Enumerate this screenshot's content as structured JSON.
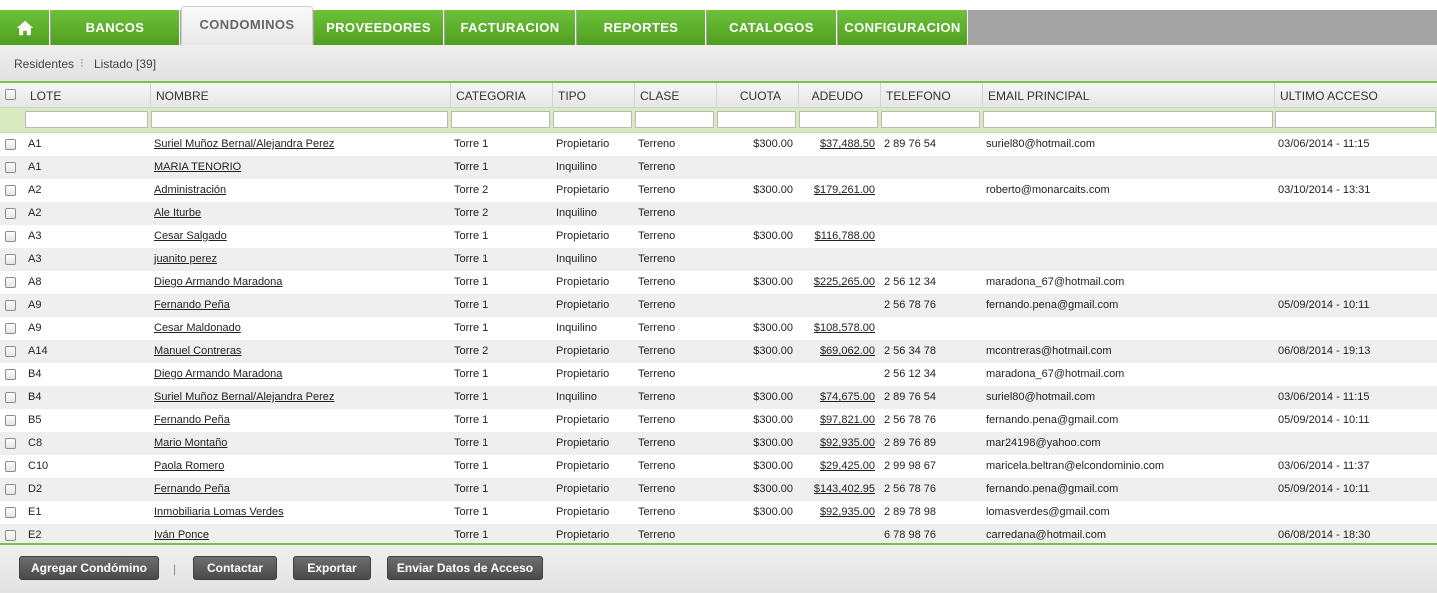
{
  "nav": {
    "home_icon": "home-icon",
    "tabs": [
      "BANCOS",
      "CONDOMINOS",
      "PROVEEDORES",
      "FACTURACION",
      "REPORTES",
      "CATALOGOS",
      "CONFIGURACION"
    ],
    "active": "CONDOMINOS"
  },
  "breadcrumb": {
    "parent": "Residentes",
    "current": "Listado [39]"
  },
  "table": {
    "headers": [
      "LOTE",
      "NOMBRE",
      "CATEGORIA",
      "TIPO",
      "CLASE",
      "CUOTA",
      "ADEUDO",
      "TELEFONO",
      "EMAIL PRINCIPAL",
      "ULTIMO ACCESO"
    ],
    "filters": [
      "",
      "",
      "",
      "",
      "",
      "",
      "",
      "",
      "",
      ""
    ],
    "rows": [
      [
        "A1",
        "Suriel Muñoz Bernal/Alejandra Perez",
        "Torre 1",
        "Propietario",
        "Terreno",
        "$300.00",
        "$37,488.50",
        "2 89 76 54",
        "suriel80@hotmail.com",
        "03/06/2014 - 11:15"
      ],
      [
        "A1",
        "MARIA TENORIO",
        "Torre 1",
        "Inquilino",
        "Terreno",
        "",
        "",
        "",
        "",
        ""
      ],
      [
        "A2",
        "Administración",
        "Torre 2",
        "Propietario",
        "Terreno",
        "$300.00",
        "$179,261.00",
        "",
        "roberto@monarcaits.com",
        "03/10/2014 - 13:31"
      ],
      [
        "A2",
        "Ale Iturbe",
        "Torre 2",
        "Inquilino",
        "Terreno",
        "",
        "",
        "",
        "",
        ""
      ],
      [
        "A3",
        "Cesar Salgado",
        "Torre 1",
        "Propietario",
        "Terreno",
        "$300.00",
        "$116,788.00",
        "",
        "",
        ""
      ],
      [
        "A3",
        "juanito perez",
        "Torre 1",
        "Inquilino",
        "Terreno",
        "",
        "",
        "",
        "",
        ""
      ],
      [
        "A8",
        "Diego Armando Maradona",
        "Torre 1",
        "Propietario",
        "Terreno",
        "$300.00",
        "$225,265.00",
        "2 56 12 34",
        "maradona_67@hotmail.com",
        ""
      ],
      [
        "A9",
        "Fernando Peña",
        "Torre 1",
        "Propietario",
        "Terreno",
        "",
        "",
        "2 56 78 76",
        "fernando.pena@gmail.com",
        "05/09/2014 - 10:11"
      ],
      [
        "A9",
        "Cesar Maldonado",
        "Torre 1",
        "Inquilino",
        "Terreno",
        "$300.00",
        "$108,578.00",
        "",
        "",
        ""
      ],
      [
        "A14",
        "Manuel Contreras",
        "Torre 2",
        "Propietario",
        "Terreno",
        "$300.00",
        "$69,062.00",
        "2 56 34 78",
        "mcontreras@hotmail.com",
        "06/08/2014 - 19:13"
      ],
      [
        "B4",
        "Diego Armando Maradona",
        "Torre 1",
        "Propietario",
        "Terreno",
        "",
        "",
        "2 56 12 34",
        "maradona_67@hotmail.com",
        ""
      ],
      [
        "B4",
        "Suriel Muñoz Bernal/Alejandra Perez",
        "Torre 1",
        "Inquilino",
        "Terreno",
        "$300.00",
        "$74,675.00",
        "2 89 76 54",
        "suriel80@hotmail.com",
        "03/06/2014 - 11:15"
      ],
      [
        "B5",
        "Fernando Peña",
        "Torre 1",
        "Propietario",
        "Terreno",
        "$300.00",
        "$97,821.00",
        "2 56 78 76",
        "fernando.pena@gmail.com",
        "05/09/2014 - 10:11"
      ],
      [
        "C8",
        "Mario Montaño",
        "Torre 1",
        "Propietario",
        "Terreno",
        "$300.00",
        "$92,935.00",
        "2 89 76 89",
        "mar24198@yahoo.com",
        ""
      ],
      [
        "C10",
        "Paola Romero",
        "Torre 1",
        "Propietario",
        "Terreno",
        "$300.00",
        "$29,425.00",
        "2 99 98 67",
        "maricela.beltran@elcondominio.com",
        "03/06/2014 - 11:37"
      ],
      [
        "D2",
        "Fernando Peña",
        "Torre 1",
        "Propietario",
        "Terreno",
        "$300.00",
        "$143,402.95",
        "2 56 78 76",
        "fernando.pena@gmail.com",
        "05/09/2014 - 10:11"
      ],
      [
        "E1",
        "Inmobiliaria Lomas Verdes",
        "Torre 1",
        "Propietario",
        "Terreno",
        "$300.00",
        "$92,935.00",
        "2 89 78 98",
        "lomasverdes@gmail.com",
        ""
      ],
      [
        "E2",
        "Iván Ponce",
        "Torre 1",
        "Propietario",
        "Terreno",
        "",
        "",
        "6 78 98 76",
        "carredana@hotmail.com",
        "06/08/2014 - 18:30"
      ]
    ]
  },
  "footer": {
    "buttons": [
      "Agregar Condómino",
      "Contactar",
      "Exportar",
      "Enviar Datos de Acceso"
    ],
    "separator": "|"
  },
  "colors": {
    "accent_green": "#5bb02b",
    "nav_gray": "#a3a3a3",
    "button_dark": "#555555"
  }
}
